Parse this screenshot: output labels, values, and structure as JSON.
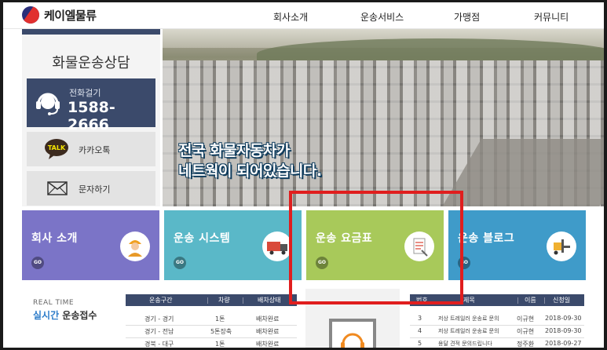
{
  "header": {
    "logo_text": "케이엘물류",
    "nav": [
      "회사소개",
      "운송서비스",
      "가맹점",
      "커뮤니티"
    ]
  },
  "sidebar": {
    "consult_title": "화물운송상담",
    "phone_label": "전화걸기",
    "phone_number": "1588-2666",
    "kakao_badge": "TALK",
    "kakao_label": "카카오톡",
    "sms_label": "문자하기"
  },
  "hero": {
    "line1": "전국 화물자동차가",
    "line2": "네트웍이 되어있습니다."
  },
  "tiles": [
    {
      "title": "회사 소개",
      "go": "GO",
      "color": "#7b74c7"
    },
    {
      "title": "운송 시스템",
      "go": "GO",
      "color": "#5ab8c8"
    },
    {
      "title": "운송 요금표",
      "go": "GO",
      "color": "#a8c95a"
    },
    {
      "title": "운송 블로그",
      "go": "GO",
      "color": "#3f9bc9"
    }
  ],
  "realtime": {
    "sub": "REAL TIME",
    "title_highlight": "실시간",
    "title_rest": " 운송접수",
    "headers": [
      "운송구간",
      "차량",
      "배차상태"
    ],
    "rows": [
      [
        "경기 - 경기",
        "1톤",
        "배차완료"
      ],
      [
        "경기 - 전남",
        "5톤장축",
        "배차완료"
      ],
      [
        "경북 - 대구",
        "1톤",
        "배차완료"
      ]
    ]
  },
  "board": {
    "headers": [
      "번호",
      "제목",
      "이름",
      "신청일"
    ],
    "rows": [
      [
        "3",
        "저상 트레일러 운송료 문의",
        "이규현",
        "2018-09-30"
      ],
      [
        "4",
        "저상 트레일러 운송료 문의",
        "이규현",
        "2018-09-30"
      ],
      [
        "5",
        "용달 견적 문의드립니다",
        "정주환",
        "2018-09-27"
      ]
    ]
  },
  "colors": {
    "navy": "#3b4a6b",
    "highlight_box": "#e01e1e"
  }
}
